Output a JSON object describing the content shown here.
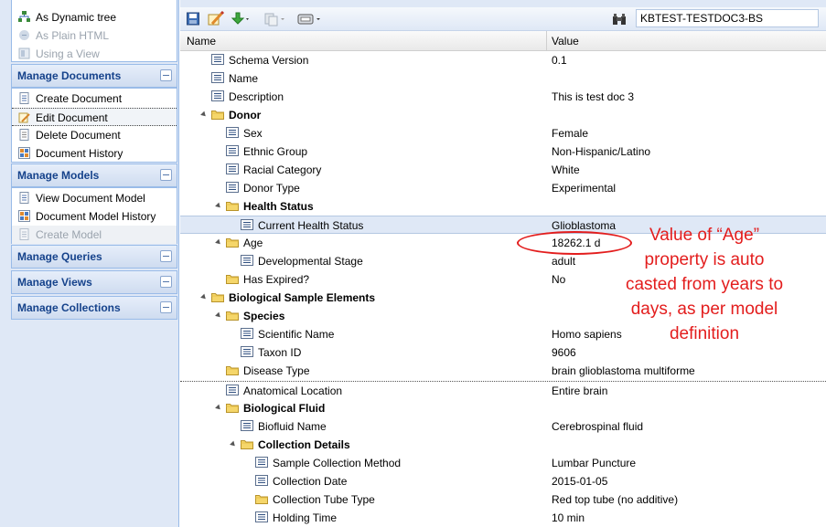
{
  "sidebar": {
    "view_section": {
      "items": [
        {
          "label": "As Dynamic tree",
          "icon": "tree-icon",
          "state": "selected"
        },
        {
          "label": "As Plain HTML",
          "icon": "html-icon",
          "state": "disabled"
        },
        {
          "label": "Using a View",
          "icon": "view-icon",
          "state": "disabled"
        }
      ]
    },
    "manage_documents": {
      "title": "Manage Documents",
      "items": [
        {
          "label": "Create Document",
          "icon": "document-icon"
        },
        {
          "label": "Edit Document",
          "icon": "edit-document-icon",
          "state": "selected"
        },
        {
          "label": "Delete Document",
          "icon": "delete-document-icon"
        },
        {
          "label": "Document History",
          "icon": "history-icon"
        }
      ]
    },
    "manage_models": {
      "title": "Manage Models",
      "items": [
        {
          "label": "View Document Model",
          "icon": "model-icon"
        },
        {
          "label": "Document Model History",
          "icon": "history-icon"
        },
        {
          "label": "Create Model",
          "icon": "create-model-icon",
          "state": "disabled"
        }
      ]
    },
    "manage_queries": {
      "title": "Manage Queries"
    },
    "manage_views": {
      "title": "Manage Views"
    },
    "manage_collections": {
      "title": "Manage Collections"
    }
  },
  "toolbar": {
    "doc_id": "KBTEST-TESTDOC3-BS",
    "buttons": [
      "save-icon",
      "edit-icon",
      "download-icon",
      "copy-icon",
      "tools-icon",
      "binoculars-icon"
    ]
  },
  "grid": {
    "columns": {
      "name": "Name",
      "value": "Value"
    },
    "rows": [
      {
        "name": "Schema Version",
        "value": "0.1",
        "type": "field",
        "level": 0
      },
      {
        "name": "Name",
        "value": "",
        "type": "field",
        "level": 0
      },
      {
        "name": "Description",
        "value": "This is test doc 3",
        "type": "field",
        "level": 0
      },
      {
        "name": "Donor",
        "value": "",
        "type": "folder",
        "level": 0,
        "bold": true,
        "expanded": true
      },
      {
        "name": "Sex",
        "value": "Female",
        "type": "field",
        "level": 1
      },
      {
        "name": "Ethnic Group",
        "value": "Non-Hispanic/Latino",
        "type": "field",
        "level": 1
      },
      {
        "name": "Racial Category",
        "value": "White",
        "type": "field",
        "level": 1
      },
      {
        "name": "Donor Type",
        "value": "Experimental",
        "type": "field",
        "level": 1
      },
      {
        "name": "Health Status",
        "value": "",
        "type": "folder",
        "level": 1,
        "bold": true,
        "expanded": true
      },
      {
        "name": "Current Health Status",
        "value": "Glioblastoma",
        "type": "field",
        "level": 2,
        "selected": true
      },
      {
        "name": "Age",
        "value": "18262.1 d",
        "type": "folder",
        "level": 1,
        "expanded": true
      },
      {
        "name": "Developmental Stage",
        "value": "adult",
        "type": "field",
        "level": 2
      },
      {
        "name": "Has Expired?",
        "value": "No",
        "type": "folder",
        "level": 1
      },
      {
        "name": "Biological Sample Elements",
        "value": "",
        "type": "folder",
        "level": 0,
        "bold": true,
        "expanded": true
      },
      {
        "name": "Species",
        "value": "",
        "type": "folder",
        "level": 1,
        "bold": true,
        "expanded": true
      },
      {
        "name": "Scientific Name",
        "value": "Homo sapiens",
        "type": "field",
        "level": 2
      },
      {
        "name": "Taxon ID",
        "value": "9606",
        "type": "field",
        "level": 2
      },
      {
        "name": "Disease Type",
        "value": "brain glioblastoma multiforme",
        "type": "folder",
        "level": 1
      },
      {
        "name": "Anatomical Location",
        "value": "Entire brain",
        "type": "field",
        "level": 1,
        "sep": true
      },
      {
        "name": "Biological Fluid",
        "value": "",
        "type": "folder",
        "level": 1,
        "bold": true,
        "expanded": true
      },
      {
        "name": "Biofluid Name",
        "value": "Cerebrospinal fluid",
        "type": "field",
        "level": 2
      },
      {
        "name": "Collection Details",
        "value": "",
        "type": "folder",
        "level": 2,
        "bold": true,
        "expanded": true
      },
      {
        "name": "Sample Collection Method",
        "value": "Lumbar Puncture",
        "type": "field",
        "level": 3
      },
      {
        "name": "Collection Date",
        "value": "2015-01-05",
        "type": "field",
        "level": 3
      },
      {
        "name": "Collection Tube Type",
        "value": "Red top tube (no additive)",
        "type": "folder",
        "level": 3
      },
      {
        "name": "Holding Time",
        "value": "10 min",
        "type": "field",
        "level": 3
      }
    ]
  },
  "annotation": {
    "lines": [
      "Value of “Age”",
      "property is auto",
      "casted from years to",
      "days, as per model",
      "definition"
    ]
  },
  "colors": {
    "annotation": "#e31d1d",
    "header_text": "#15428b"
  }
}
